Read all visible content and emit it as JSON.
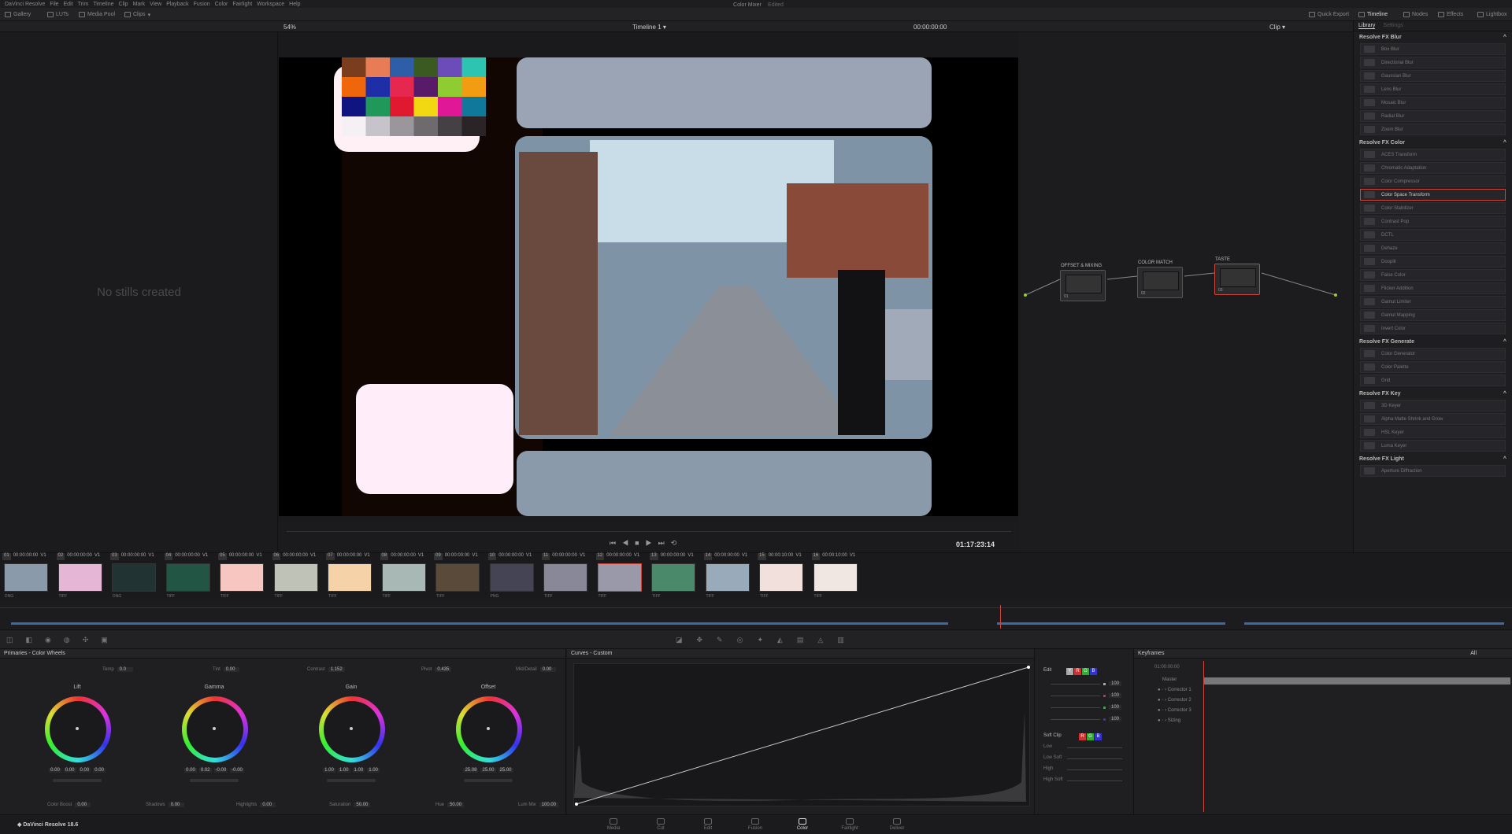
{
  "menubar": {
    "items": [
      "DaVinci Resolve",
      "File",
      "Edit",
      "Trim",
      "Timeline",
      "Clip",
      "Mark",
      "View",
      "Playback",
      "Fusion",
      "Color",
      "Fairlight",
      "Workspace",
      "Help"
    ],
    "title": "Color Mixer",
    "status": "Edited"
  },
  "toolbar": {
    "gallery": "Gallery",
    "luts": "LUTs",
    "media_pool": "Media Pool",
    "clips": "Clips",
    "quick_export": "Quick Export",
    "timeline": "Timeline",
    "nodes": "Nodes",
    "effects": "Effects",
    "lightbox": "Lightbox"
  },
  "subbar": {
    "zoom": "54%",
    "timeline_name": "Timeline 1",
    "timecode": "00:00:00:00",
    "clip_mode": "Clip"
  },
  "gallery": {
    "empty_message": "No stills created"
  },
  "viewer": {
    "timecode": "01:17:23:14"
  },
  "library": {
    "tabs": [
      "Library",
      "Settings"
    ],
    "sections": [
      {
        "title": "Resolve FX Blur",
        "items": [
          "Box Blur",
          "Directional Blur",
          "Gaussian Blur",
          "Lens Blur",
          "Mosaic Blur",
          "Radial Blur",
          "Zoom Blur"
        ]
      },
      {
        "title": "Resolve FX Color",
        "items": [
          "ACES Transform",
          "Chromatic Adaptation",
          "Color Compressor",
          "Color Space Transform",
          "Color Stabilizer",
          "Contrast Pop",
          "DCTL",
          "Dehaze",
          "Dooplit",
          "False Color",
          "Flicker Addition",
          "Gamut Limiter",
          "Gamut Mapping",
          "Invert Color"
        ]
      },
      {
        "title": "Resolve FX Generate",
        "items": [
          "Color Generator",
          "Color Palette",
          "Grid"
        ]
      },
      {
        "title": "Resolve FX Key",
        "items": [
          "3D Keyer",
          "Alpha Matte Shrink and Grow",
          "HSL Keyer",
          "Luma Keyer"
        ]
      },
      {
        "title": "Resolve FX Light",
        "items": [
          "Aperture Diffraction"
        ]
      }
    ],
    "selected": "Color Space Transform"
  },
  "nodes": [
    {
      "label": "OFFSET & MIXING",
      "num": "01"
    },
    {
      "label": "COLOR MATCH",
      "num": "02"
    },
    {
      "label": "TASTE",
      "num": "03"
    }
  ],
  "clips": [
    {
      "num": "01",
      "tc": "00:00:00:00",
      "track": "V1",
      "fmt": "DNG",
      "color": "#8a9aaa"
    },
    {
      "num": "02",
      "tc": "00:00:00:00",
      "track": "V1",
      "fmt": "TIFF",
      "color": "#e6b6d6"
    },
    {
      "num": "03",
      "tc": "00:00:00:00",
      "track": "V1",
      "fmt": "DNG",
      "color": "#233"
    },
    {
      "num": "04",
      "tc": "00:00:00:00",
      "track": "V1",
      "fmt": "TIFF",
      "color": "#254"
    },
    {
      "num": "05",
      "tc": "00:00:00:00",
      "track": "V1",
      "fmt": "TIFF",
      "color": "#f7c6c0"
    },
    {
      "num": "06",
      "tc": "00:00:00:00",
      "track": "V1",
      "fmt": "TIFF",
      "color": "#bfc2b6"
    },
    {
      "num": "07",
      "tc": "00:00:00:00",
      "track": "V1",
      "fmt": "TIFF",
      "color": "#f6d2a8"
    },
    {
      "num": "08",
      "tc": "00:00:00:00",
      "track": "V1",
      "fmt": "TIFF",
      "color": "#a8b8b4"
    },
    {
      "num": "09",
      "tc": "00:00:00:00",
      "track": "V1",
      "fmt": "TIFF",
      "color": "#5a4a3a"
    },
    {
      "num": "10",
      "tc": "00:00:00:00",
      "track": "V1",
      "fmt": "PNG",
      "color": "#445"
    },
    {
      "num": "11",
      "tc": "00:00:00:00",
      "track": "V1",
      "fmt": "TIFF",
      "color": "#889"
    },
    {
      "num": "12",
      "tc": "00:00:00:00",
      "track": "V1",
      "fmt": "TIFF",
      "color": "#99a"
    },
    {
      "num": "13",
      "tc": "00:00:00:00",
      "track": "V1",
      "fmt": "TIFF",
      "color": "#4a8a6a"
    },
    {
      "num": "14",
      "tc": "00:00:00:00",
      "track": "V1",
      "fmt": "TIFF",
      "color": "#9ab"
    },
    {
      "num": "15",
      "tc": "00:00:10:00",
      "track": "V1",
      "fmt": "TIFF",
      "color": "#f2e0dc"
    },
    {
      "num": "16",
      "tc": "00:00:10:00",
      "track": "V1",
      "fmt": "TIFF",
      "color": "#f0e6e2"
    }
  ],
  "primaries": {
    "title": "Primaries - Color Wheels",
    "temp_label": "Temp",
    "temp": "0.0",
    "tint_label": "Tint",
    "tint": "0.00",
    "contrast_label": "Contrast",
    "contrast": "1.152",
    "pivot_label": "Pivot",
    "pivot": "0.435",
    "middetail_label": "Mid/Detail",
    "middetail": "0.00",
    "wheels": [
      {
        "name": "Lift",
        "vals": [
          "0.00",
          "0.00",
          "0.00",
          "0.00"
        ]
      },
      {
        "name": "Gamma",
        "vals": [
          "0.00",
          "0.02",
          "-0.00",
          "-0.00"
        ]
      },
      {
        "name": "Gain",
        "vals": [
          "1.00",
          "1.00",
          "1.00",
          "1.00"
        ]
      },
      {
        "name": "Offset",
        "vals": [
          "25.08",
          "25.00",
          "25.00"
        ]
      }
    ],
    "colorboost_label": "Color Boost",
    "colorboost": "0.00",
    "shadows_label": "Shadows",
    "shadows": "0.00",
    "highlights_label": "Highlights",
    "highlights": "0.00",
    "saturation_label": "Saturation",
    "saturation": "50.00",
    "hue_label": "Hue",
    "hue": "50.00",
    "lummix_label": "Lum Mix",
    "lummix": "100.00"
  },
  "curves": {
    "title": "Curves - Custom",
    "edit_label": "Edit",
    "channel_values": [
      "100",
      "100",
      "100",
      "100"
    ],
    "softclip_label": "Soft Clip",
    "softclip_rows": [
      "Low",
      "Low Soft",
      "High",
      "High Soft"
    ]
  },
  "keyframes": {
    "title": "Keyframes",
    "filter": "All",
    "tc": "01:00:00:00",
    "rows": [
      "Master",
      "Corrector 1",
      "Corrector 2",
      "Corrector 3",
      "Sizing"
    ]
  },
  "bottomnav": {
    "app": "DaVinci Resolve 18.6",
    "pages": [
      "Media",
      "Cut",
      "Edit",
      "Fusion",
      "Color",
      "Fairlight",
      "Deliver"
    ],
    "active": "Color"
  },
  "colors": {
    "accent": "#d0453a",
    "blue": "#3a7bd5"
  }
}
